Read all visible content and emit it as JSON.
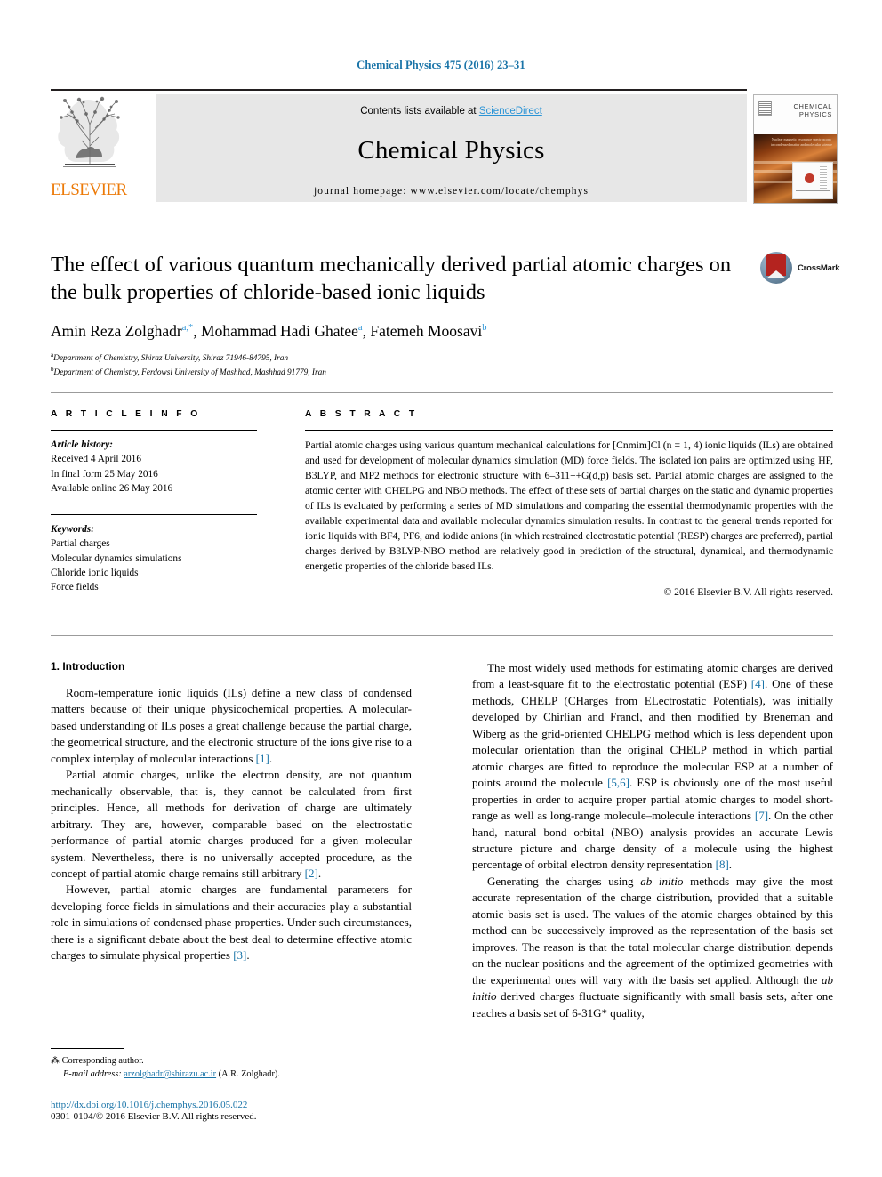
{
  "running_head": "Chemical Physics 475 (2016) 23–31",
  "masthead": {
    "contents_prefix": "Contents lists available at ",
    "sciencedirect": "ScienceDirect",
    "journal_title": "Chemical Physics",
    "homepage": "journal homepage: www.elsevier.com/locate/chemphys",
    "publisher": "ELSEVIER",
    "cover_title_line1": "CHEMICAL",
    "cover_title_line2": "PHYSICS",
    "cover_caption": "Nuclear magnetic resonance spectroscopy in condensed matter and molecular science"
  },
  "article": {
    "title": "The effect of various quantum mechanically derived partial atomic charges on the bulk properties of chloride-based ionic liquids",
    "authors_plain": "Amin Reza Zolghadr a,*, Mohammad Hadi Ghatee a, Fatemeh Moosavi b",
    "affiliation_a": "Department of Chemistry, Shiraz University, Shiraz 71946-84795, Iran",
    "affiliation_b": "Department of Chemistry, Ferdowsi University of Mashhad, Mashhad 91779, Iran",
    "crossmark_label": "CrossMark"
  },
  "info": {
    "heading": "A R T I C L E  I N F O",
    "history_label": "Article history:",
    "history": [
      "Received 4 April 2016",
      "In final form 25 May 2016",
      "Available online 26 May 2016"
    ],
    "keywords_label": "Keywords:",
    "keywords": [
      "Partial charges",
      "Molecular dynamics simulations",
      "Chloride ionic liquids",
      "Force fields"
    ]
  },
  "abstract": {
    "heading": "A B S T R A C T",
    "text": "Partial atomic charges using various quantum mechanical calculations for [Cnmim]Cl (n = 1, 4) ionic liquids (ILs) are obtained and used for development of molecular dynamics simulation (MD) force fields. The isolated ion pairs are optimized using HF, B3LYP, and MP2 methods for electronic structure with 6–311++G(d,p) basis set. Partial atomic charges are assigned to the atomic center with CHELPG and NBO methods. The effect of these sets of partial charges on the static and dynamic properties of ILs is evaluated by performing a series of MD simulations and comparing the essential thermodynamic properties with the available experimental data and available molecular dynamics simulation results. In contrast to the general trends reported for ionic liquids with BF4, PF6, and iodide anions (in which restrained electrostatic potential (RESP) charges are preferred), partial charges derived by B3LYP-NBO method are relatively good in prediction of the structural, dynamical, and thermodynamic energetic properties of the chloride based ILs.",
    "copyright": "© 2016 Elsevier B.V. All rights reserved."
  },
  "body": {
    "section_heading": "1. Introduction",
    "left_paragraphs": [
      "Room-temperature ionic liquids (ILs) define a new class of condensed matters because of their unique physicochemical properties. A molecular-based understanding of ILs poses a great challenge because the partial charge, the geometrical structure, and the electronic structure of the ions give rise to a complex interplay of molecular interactions [1].",
      "Partial atomic charges, unlike the electron density, are not quantum mechanically observable, that is, they cannot be calculated from first principles. Hence, all methods for derivation of charge are ultimately arbitrary. They are, however, comparable based on the electrostatic performance of partial atomic charges produced for a given molecular system. Nevertheless, there is no universally accepted procedure, as the concept of partial atomic charge remains still arbitrary [2].",
      "However, partial atomic charges are fundamental parameters for developing force fields in simulations and their accuracies play a substantial role in simulations of condensed phase properties. Under such circumstances, there is a significant debate about the best deal to determine effective atomic charges to simulate physical properties [3]."
    ],
    "right_paragraphs": [
      "The most widely used methods for estimating atomic charges are derived from a least-square fit to the electrostatic potential (ESP) [4]. One of these methods, CHELP (CHarges from ELectrostatic Potentials), was initially developed by Chirlian and Francl, and then modified by Breneman and Wiberg as the grid-oriented CHELPG method which is less dependent upon molecular orientation than the original CHELP method in which partial atomic charges are fitted to reproduce the molecular ESP at a number of points around the molecule [5,6]. ESP is obviously one of the most useful properties in order to acquire proper partial atomic charges to model short-range as well as long-range molecule–molecule interactions [7]. On the other hand, natural bond orbital (NBO) analysis provides an accurate Lewis structure picture and charge density of a molecule using the highest percentage of orbital electron density representation [8].",
      "Generating the charges using ab initio methods may give the most accurate representation of the charge distribution, provided that a suitable atomic basis set is used. The values of the atomic charges obtained by this method can be successively improved as the representation of the basis set improves. The reason is that the total molecular charge distribution depends on the nuclear positions and the agreement of the optimized geometries with the experimental ones will vary with the basis set applied. Although the ab initio derived charges fluctuate significantly with small basis sets, after one reaches a basis set of 6-31G* quality,"
    ]
  },
  "footnote": {
    "corresponding": "Corresponding author.",
    "email_label": "E-mail address:",
    "email": "arzolghadr@shirazu.ac.ir",
    "email_suffix": "(A.R. Zolghadr).",
    "doi": "http://dx.doi.org/10.1016/j.chemphys.2016.05.022",
    "issn_line": "0301-0104/© 2016 Elsevier B.V. All rights reserved."
  },
  "colors": {
    "link": "#1a74a8",
    "sciencedirect": "#2b94d6",
    "elsevier_orange": "#ec7a08",
    "crossmark_red": "#b4231f"
  }
}
